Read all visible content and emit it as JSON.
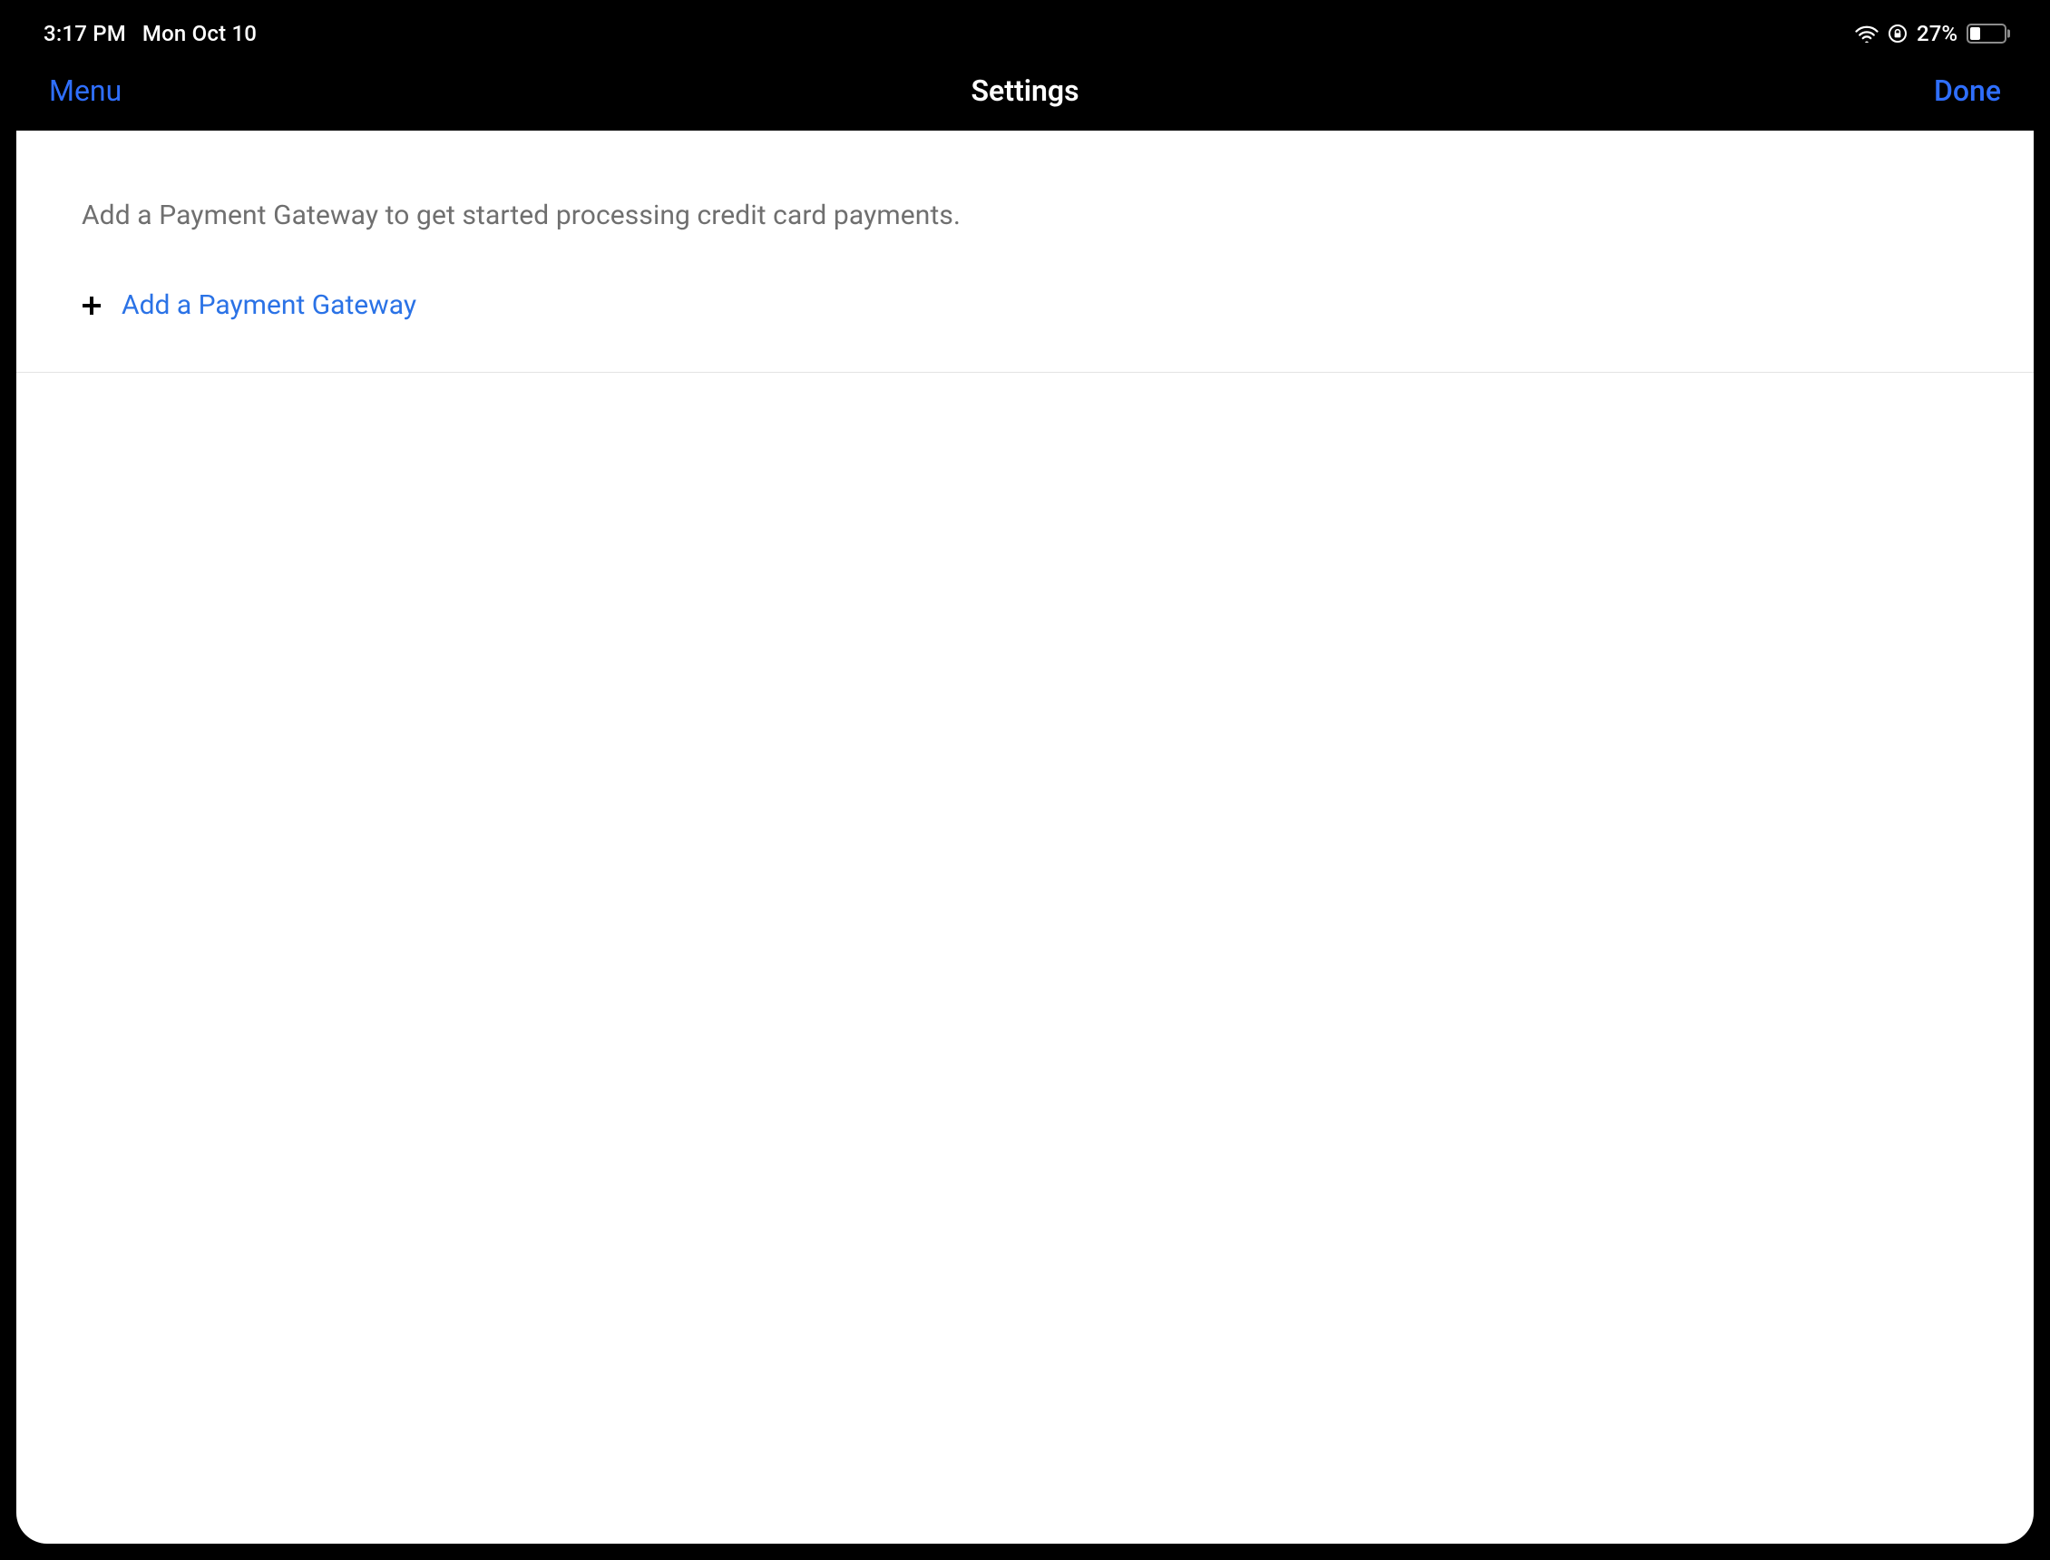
{
  "status_bar": {
    "time": "3:17 PM",
    "date": "Mon Oct 10",
    "battery_percent": "27%",
    "battery_fill_pct": 27
  },
  "nav": {
    "menu_label": "Menu",
    "title": "Settings",
    "done_label": "Done"
  },
  "content": {
    "instruction": "Add a Payment Gateway to get started processing credit card payments.",
    "add_gateway_label": "Add a Payment Gateway"
  },
  "colors": {
    "accent": "#2f6fff",
    "link": "#2a72e6",
    "muted_text": "#6f6f6f",
    "divider": "#e3e3e3"
  }
}
